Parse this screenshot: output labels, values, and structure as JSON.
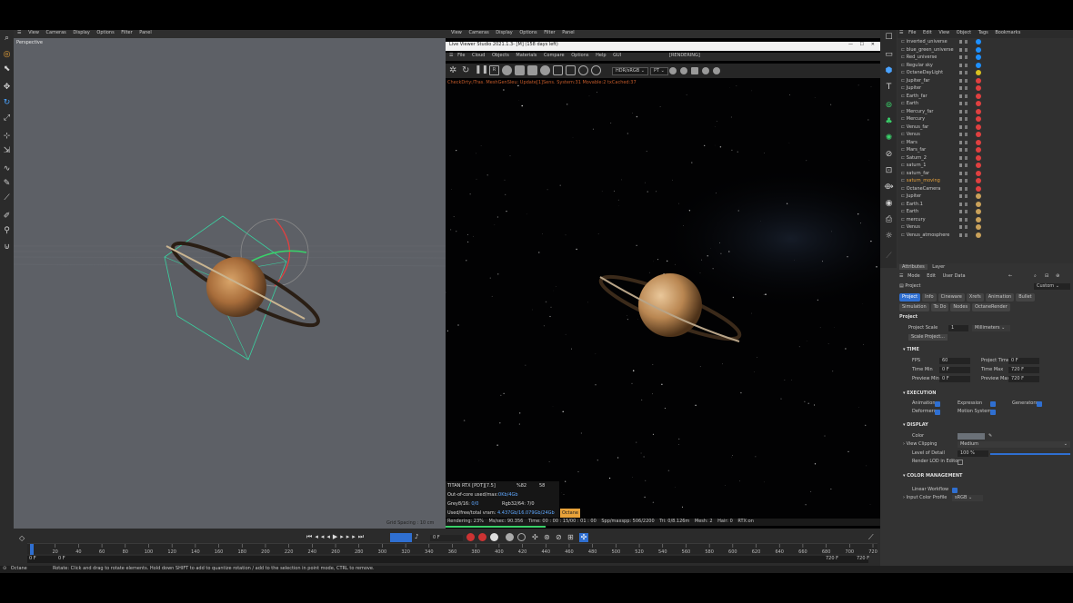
{
  "viewport": {
    "menu": [
      "View",
      "Cameras",
      "Display",
      "Options",
      "Filter",
      "Panel"
    ],
    "label": "Perspective",
    "grid_spacing": "Grid Spacing : 10 cm"
  },
  "live_viewer": {
    "menu_outer": [
      "View",
      "Cameras",
      "Display",
      "Options",
      "Filter",
      "Panel"
    ],
    "title": "Live Viewer Studio 2021.1.3- [M] (158 days left)",
    "menu": [
      "File",
      "Cloud",
      "Objects",
      "Materials",
      "Compare",
      "Options",
      "Help",
      "GUI"
    ],
    "mode_select": "HDR/sRGB",
    "pt_select": "PT",
    "rendering_label": "[RENDERING]",
    "check_line": "CheckDrty:/Tras. MeshGenSleu: Update[1]Sens. System:31 Movable:2 txCached:37",
    "stats": [
      {
        "label": "TITAN RTX [PDT][7.5]",
        "v1": "%82",
        "v2": "58"
      },
      {
        "label": "Out-of-core used/max:",
        "v1": "0Kb/4Gb",
        "v2": ""
      },
      {
        "label": "Grey8/16:",
        "v1": "0/0",
        "v2": "Rgb32/64: 7/0"
      },
      {
        "label": "Used/free/total vram:",
        "v1": "4.437Gb/16.079Gb/24Gb",
        "v2": "Octane"
      }
    ],
    "status": {
      "rendering": "Rendering: 23%",
      "ms": "Ms/sec: 90.356",
      "time": "Time: 00 : 00 : 15/00 : 01 : 00",
      "spp": "Spp/maxspp: 506/2200",
      "tri": "Tri: 0/8.126m",
      "mesh": "Mesh: 2",
      "hair": "Hair: 0",
      "rtx": "RTX:on"
    }
  },
  "object_manager": {
    "menu": [
      "File",
      "Edit",
      "View",
      "Object",
      "Tags",
      "Bookmarks"
    ],
    "objects": [
      {
        "name": "inverted_universe",
        "color": "#1e90ff",
        "highlight": false
      },
      {
        "name": "blue_green_universe",
        "color": "#1e90ff",
        "highlight": false
      },
      {
        "name": "Red_universe",
        "color": "#1e90ff",
        "highlight": false
      },
      {
        "name": "Regular sky",
        "color": "#1e90ff",
        "highlight": false
      },
      {
        "name": "OctaneDayLight",
        "color": "#d8c020",
        "highlight": false
      },
      {
        "name": "Jupiter_far",
        "color": "#e04040",
        "highlight": false
      },
      {
        "name": "Jupiter",
        "color": "#e04040",
        "highlight": false
      },
      {
        "name": "Earth_far",
        "color": "#e04040",
        "highlight": false
      },
      {
        "name": "Earth",
        "color": "#e04040",
        "highlight": false
      },
      {
        "name": "Mercury_far",
        "color": "#e04040",
        "highlight": false
      },
      {
        "name": "Mercury",
        "color": "#e04040",
        "highlight": false
      },
      {
        "name": "Venus_far",
        "color": "#e04040",
        "highlight": false
      },
      {
        "name": "Venus",
        "color": "#e04040",
        "highlight": false
      },
      {
        "name": "Mars",
        "color": "#e04040",
        "highlight": false
      },
      {
        "name": "Mars_far",
        "color": "#e04040",
        "highlight": false
      },
      {
        "name": "Saturn_2",
        "color": "#e04040",
        "highlight": false
      },
      {
        "name": "saturn_1",
        "color": "#e04040",
        "highlight": false
      },
      {
        "name": "saturn_far",
        "color": "#e04040",
        "highlight": false
      },
      {
        "name": "saturn_moving",
        "color": "#e04040",
        "highlight": true
      },
      {
        "name": "OctaneCamera",
        "color": "#e04040",
        "highlight": false
      },
      {
        "name": "Jupiter",
        "color": "#c9a15a",
        "highlight": false
      },
      {
        "name": "Earth.1",
        "color": "#c9a15a",
        "highlight": false
      },
      {
        "name": "Earth",
        "color": "#c9a15a",
        "highlight": false
      },
      {
        "name": "mercury",
        "color": "#c9a15a",
        "highlight": false
      },
      {
        "name": "Venus",
        "color": "#c9a15a",
        "highlight": false
      },
      {
        "name": "Venus_atmosphere",
        "color": "#c9a15a",
        "highlight": false
      }
    ]
  },
  "attributes": {
    "tabs": [
      "Attributes",
      "Layer"
    ],
    "menu": [
      "Mode",
      "Edit",
      "User Data"
    ],
    "project_label": "Project",
    "custom": "Custom",
    "subtabs": [
      "Project",
      "Info",
      "Cineware",
      "Xrefs",
      "Animation",
      "Bullet",
      "Simulation",
      "To Do",
      "Nodes",
      "OctaneRender"
    ],
    "heading": "Project",
    "project_scale_label": "Project Scale",
    "project_scale_value": "1",
    "project_scale_unit": "Millimeters",
    "scale_project_btn": "Scale Project...",
    "time_section": "TIME",
    "fps_label": "FPS",
    "fps": "60",
    "project_time_label": "Project Time",
    "project_time": "0 F",
    "time_min_label": "Time Min",
    "time_min": "0 F",
    "time_max_label": "Time Max",
    "time_max": "720 F",
    "preview_min_label": "Preview Min",
    "preview_min": "0 F",
    "preview_max_label": "Preview Max",
    "preview_max": "720 F",
    "execution_section": "EXECUTION",
    "animation_label": "Animation",
    "expression_label": "Expression",
    "generators_label": "Generators",
    "deformers_label": "Deformers",
    "motion_system_label": "Motion System",
    "display_section": "DISPLAY",
    "color_label": "Color",
    "view_clipping_label": "View Clipping",
    "view_clipping": "Medium",
    "lod_label": "Level of Detail",
    "lod": "100 %",
    "lod_fraction": 1.0,
    "render_lod_label": "Render LOD in Editor",
    "color_mgmt_section": "COLOR MANAGEMENT",
    "linear_workflow_label": "Linear Workflow",
    "input_color_profile_label": "Input Color Profile",
    "input_color_profile": "sRGB"
  },
  "timeline": {
    "ticks": [
      "0",
      "20",
      "40",
      "60",
      "80",
      "100",
      "120",
      "140",
      "160",
      "180",
      "200",
      "220",
      "240",
      "260",
      "280",
      "300",
      "320",
      "340",
      "360",
      "380",
      "400",
      "420",
      "440",
      "460",
      "480",
      "500",
      "520",
      "540",
      "560",
      "580",
      "600",
      "620",
      "640",
      "660",
      "680",
      "700",
      "720"
    ],
    "current_frame": "0 F",
    "start": "0 F",
    "start2": "0 F",
    "end": "720 F",
    "end2": "720 F"
  },
  "status_bar": {
    "app": "Octane",
    "hint": "Rotate: Click and drag to rotate elements. Hold down SHIFT to add to quantize rotation / add to the selection in point mode, CTRL to remove."
  },
  "colors": {
    "accent": "#2f6fd1",
    "highlight": "#e8a23a",
    "green": "#3ad16a"
  }
}
